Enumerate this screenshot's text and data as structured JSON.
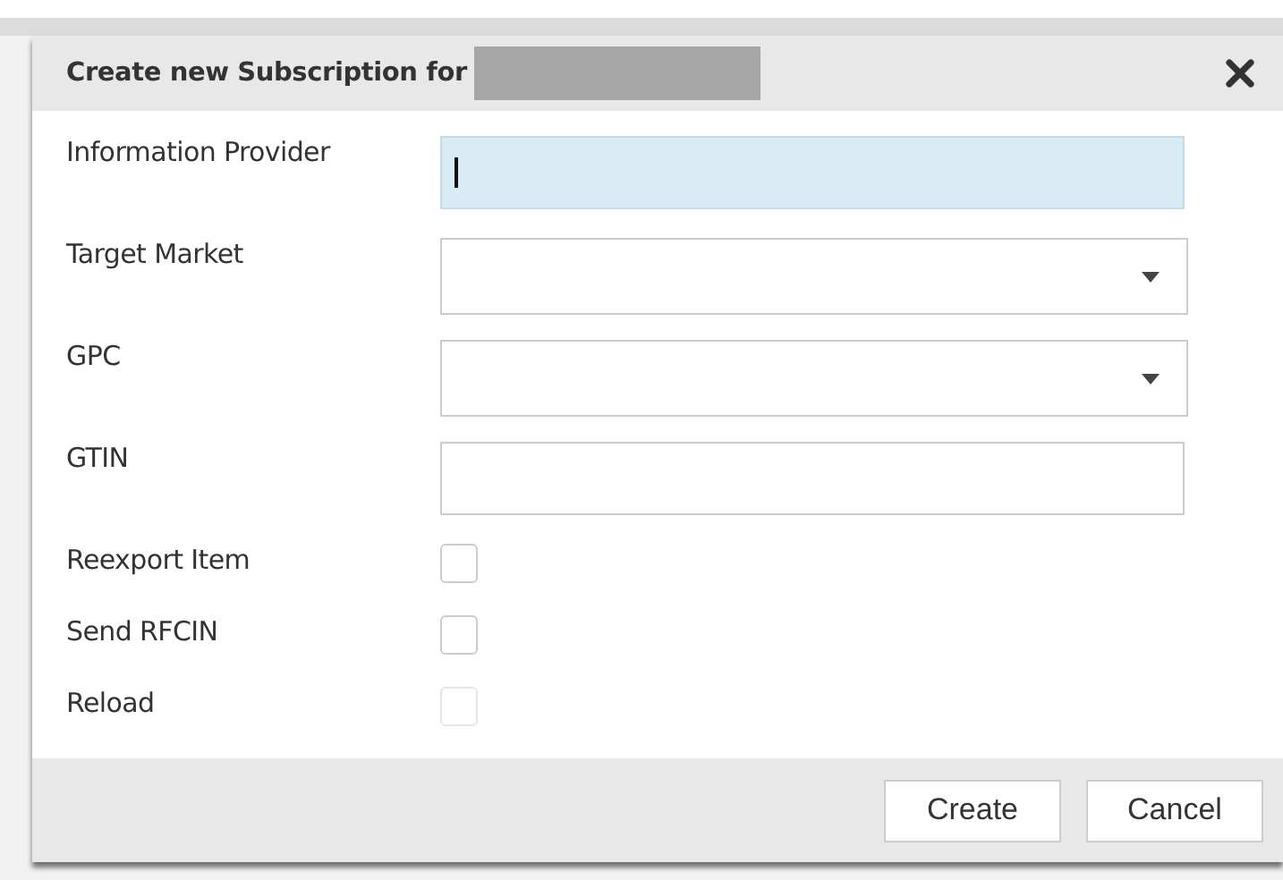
{
  "dialog": {
    "title": "Create new Subscription for",
    "fields": [
      {
        "kind": "text",
        "label": "Information Provider",
        "focused": true
      },
      {
        "kind": "select",
        "label": "Target Market",
        "focused": false
      },
      {
        "kind": "select",
        "label": "GPC",
        "focused": false
      },
      {
        "kind": "text",
        "label": "GTIN",
        "focused": false
      },
      {
        "kind": "checkbox",
        "label": "Reexport Item",
        "checked": false,
        "disabled": false
      },
      {
        "kind": "checkbox",
        "label": "Send RFCIN",
        "checked": false,
        "disabled": false
      },
      {
        "kind": "checkbox",
        "label": "Reload",
        "checked": false,
        "disabled": true
      }
    ],
    "buttons": [
      "Create",
      "Cancel"
    ]
  }
}
